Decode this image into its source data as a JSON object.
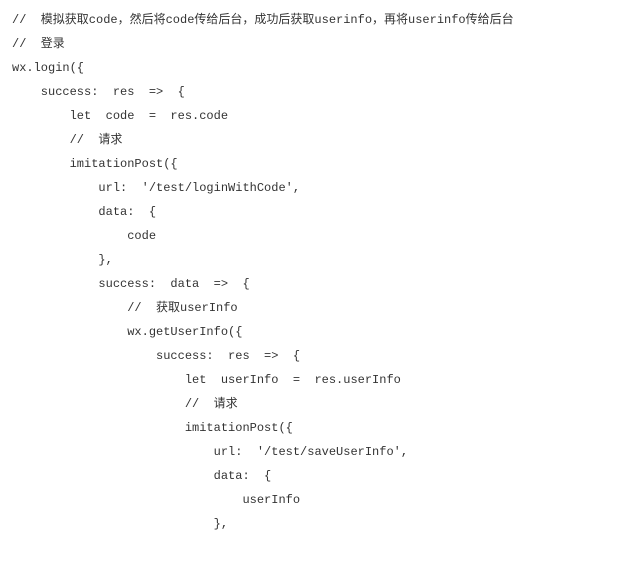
{
  "code": {
    "lines": [
      "//  模拟获取code，然后将code传给后台，成功后获取userinfo，再将userinfo传给后台",
      "//  登录",
      "wx.login({",
      "    success:  res  =>  {",
      "        let  code  =  res.code",
      "        //  请求",
      "        imitationPost({",
      "            url:  '/test/loginWithCode',",
      "            data:  {",
      "                code",
      "            },",
      "            success:  data  =>  {",
      "                //  获取userInfo",
      "                wx.getUserInfo({",
      "                    success:  res  =>  {",
      "                        let  userInfo  =  res.userInfo",
      "                        //  请求",
      "                        imitationPost({",
      "                            url:  '/test/saveUserInfo',",
      "                            data:  {",
      "                                userInfo",
      "                            },"
    ]
  }
}
